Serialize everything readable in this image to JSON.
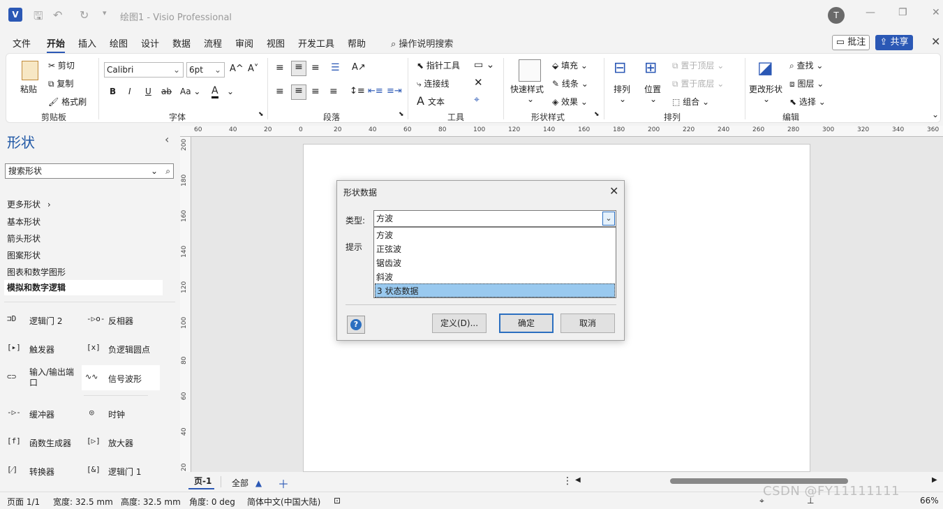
{
  "titlebar": {
    "logo": "V",
    "title": "绘图1  -  Visio Professional",
    "avatar": "T",
    "minimize": "—",
    "restore": "❐",
    "close": "✕"
  },
  "tabs": [
    "文件",
    "开始",
    "插入",
    "绘图",
    "设计",
    "数据",
    "流程",
    "审阅",
    "视图",
    "开发工具",
    "帮助"
  ],
  "tell_me": "操作说明搜索",
  "comment_btn": "批注",
  "share_btn": "共享",
  "ribbon": {
    "clipboard": {
      "paste": "粘贴",
      "cut": "剪切",
      "copy": "复制",
      "format_painter": "格式刷",
      "label": "剪贴板"
    },
    "font": {
      "name": "Calibri",
      "size": "6pt",
      "bold": "B",
      "italic": "I",
      "underline": "U",
      "strike": "ab",
      "case": "Aa",
      "color": "A",
      "grow": "A^",
      "shrink": "A˅",
      "label": "字体"
    },
    "paragraph": {
      "label": "段落"
    },
    "tools": {
      "pointer": "指针工具",
      "connector": "连接线",
      "text": "文本",
      "label": "工具"
    },
    "shape_styles": {
      "quick": "快速样式",
      "fill": "填充",
      "line": "线条",
      "effects": "效果",
      "label": "形状样式"
    },
    "arrange": {
      "arrange": "排列",
      "position": "位置",
      "bring_front": "置于顶层",
      "send_back": "置于底层",
      "group": "组合",
      "label": "排列"
    },
    "editing": {
      "change_shape": "更改形状",
      "find": "查找",
      "layers": "图层",
      "select": "选择",
      "label": "编辑"
    }
  },
  "shapes_panel": {
    "title": "形状",
    "search_placeholder": "搜索形状",
    "more": "更多形状",
    "stencils": [
      "基本形状",
      "箭头形状",
      "图案形状",
      "图表和数学图形",
      "模拟和数字逻辑"
    ],
    "items": [
      {
        "icon": "⊐D",
        "label": "逻辑门 2"
      },
      {
        "icon": "-▷o-",
        "label": "反相器"
      },
      {
        "icon": "[▸]",
        "label": "触发器"
      },
      {
        "icon": "[x]",
        "label": "负逻辑圆点"
      },
      {
        "icon": "⊂⊃",
        "label": "输入/输出端口"
      },
      {
        "icon": "∿∿",
        "label": "信号波形"
      },
      {
        "icon": "-▷-",
        "label": "缓冲器"
      },
      {
        "icon": "◎",
        "label": "时钟"
      },
      {
        "icon": "[f]",
        "label": "函数生成器"
      },
      {
        "icon": "[▷]",
        "label": "放大器"
      },
      {
        "icon": "[⁄]",
        "label": "转换器"
      },
      {
        "icon": "[&]",
        "label": "逻辑门 1"
      }
    ]
  },
  "hruler": [
    "60",
    "40",
    "20",
    "0",
    "20",
    "40",
    "60",
    "80",
    "100",
    "120",
    "140",
    "160",
    "180",
    "200",
    "220",
    "240",
    "260",
    "280",
    "300",
    "320",
    "340",
    "360"
  ],
  "vruler": [
    "200",
    "180",
    "160",
    "140",
    "120",
    "100",
    "80",
    "60",
    "40",
    "20"
  ],
  "dialog": {
    "title": "形状数据",
    "type_label": "类型:",
    "hint_label": "提示",
    "selected": "方波",
    "options": [
      "方波",
      "正弦波",
      "锯齿波",
      "斜波",
      "3 状态数据"
    ],
    "highlighted_option": "3 状态数据",
    "define_btn": "定义(D)...",
    "ok_btn": "确定",
    "cancel_btn": "取消"
  },
  "page_tabs": {
    "current": "页-1",
    "all": "全部",
    "add": "＋"
  },
  "status": {
    "page": "页面 1/1",
    "width": "宽度: 32.5 mm",
    "height": "高度: 32.5 mm",
    "angle": "角度: 0 deg",
    "language": "简体中文(中国大陆)",
    "zoom": "66%"
  },
  "watermark": "CSDN @FY11111111"
}
